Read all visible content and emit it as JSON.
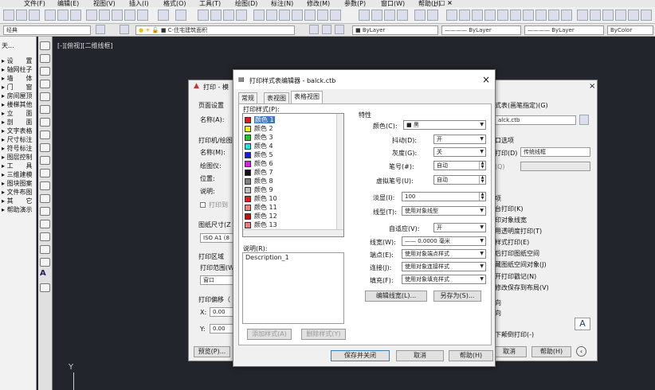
{
  "menubar": {
    "items": [
      "文件(F)",
      "编辑(E)",
      "视图(V)",
      "插入(I)",
      "格式(O)",
      "工具(T)",
      "绘图(D)",
      "标注(N)",
      "修改(M)",
      "参数(P)",
      "窗口(W)",
      "帮助(H)"
    ]
  },
  "toolbar2": {
    "workspace": "经典",
    "layer": "C-住宅建筑面积",
    "bylayer1": "ByLayer",
    "bylayer2": "ByLayer",
    "bylayer3": "ByLayer",
    "bycolor": "ByColor"
  },
  "leftpanel": {
    "title": "天...",
    "items": [
      "设　　置",
      "轴网柱子",
      "墙　　体",
      "门　　窗",
      "房间屋顶",
      "楼梯其他",
      "立　　面",
      "剖　　面",
      "文字表格",
      "尺寸标注",
      "符号标注",
      "图层控制",
      "工　　具",
      "三维建模",
      "图块图案",
      "文件布图",
      "其　　它",
      "帮助演示"
    ]
  },
  "viewport": {
    "label": "[-][俯视][二维线框]",
    "axis_y": "Y"
  },
  "print_dialog": {
    "title_part": "打印 - 模",
    "page_setup": "页面设置",
    "name_label": "名称(A):",
    "printer_section": "打印机/绘图",
    "printer_name": "名称(M):",
    "plotter": "绘图仪:",
    "location": "位置:",
    "description": "说明:",
    "print_to_file": "打印到",
    "paper_size": "图纸尺寸(Z",
    "paper_value": "ISO A1 (8",
    "print_area": "打印区域",
    "print_range": "打印范围(W",
    "range_value": "窗口",
    "print_offset": "打印偏移（",
    "x_label": "X:",
    "x_value": "0.00",
    "y_label": "Y:",
    "y_value": "0.00",
    "preview_btn": "预览(P)...",
    "right_style_table": "式表(画笔指定)(G)",
    "ctb_value": "alck.ctb",
    "shaded_viewport": "口选项",
    "shade_print": "打印(D)",
    "shade_value": "传统线框",
    "quality": "(Q)",
    "options": "项",
    "opts": [
      "台打印(K)",
      "印对象线宽",
      "用透明度打印(T)",
      "样式打印(E)",
      "后打印图纸空间",
      "藏图纸空间对象(J)",
      "开打印戳记(N)",
      "修改保存到布局(V)"
    ],
    "orientation": [
      "向",
      "向",
      "下颠倒打印(-)"
    ],
    "cancel": "取消",
    "help": "帮助(H)",
    "orientation_icon": "A"
  },
  "editor": {
    "title": "打印样式表编辑器 - balck.ctb",
    "close": "×",
    "tabs": [
      "常规",
      "表视图",
      "表格视图"
    ],
    "print_styles_label": "打印样式(P):",
    "styles": [
      {
        "name": "颜色 1",
        "color": "#e21c1c"
      },
      {
        "name": "颜色 2",
        "color": "#f2f21a"
      },
      {
        "name": "颜色 3",
        "color": "#1ccc1c"
      },
      {
        "name": "颜色 4",
        "color": "#1ae6e6"
      },
      {
        "name": "颜色 5",
        "color": "#1a1ae6"
      },
      {
        "name": "颜色 6",
        "color": "#e61ae6"
      },
      {
        "name": "颜色 7",
        "color": "#111111"
      },
      {
        "name": "颜色 8",
        "color": "#808080"
      },
      {
        "name": "颜色 9",
        "color": "#c0c0c0"
      },
      {
        "name": "颜色 10",
        "color": "#e21c1c"
      },
      {
        "name": "颜色 11",
        "color": "#f08080"
      },
      {
        "name": "颜色 12",
        "color": "#c01010"
      },
      {
        "name": "颜色 13",
        "color": "#e08080"
      }
    ],
    "desc_label": "说明(R):",
    "desc_value": "Description_1",
    "add_style": "添加样式(A)",
    "delete_style": "删除样式(Y)",
    "props_label": "特性",
    "color_label": "颜色(C):",
    "color_value": "■ 黑",
    "dither_label": "抖动(D):",
    "dither_value": "开",
    "gray_label": "灰度(G):",
    "gray_value": "关",
    "pen_label": "笔号(#):",
    "pen_value": "自动",
    "vpen_label": "虚拟笔号(U):",
    "vpen_value": "自动",
    "screen_label": "淡显(I):",
    "screen_value": "100",
    "linetype_label": "线型(T):",
    "linetype_value": "使用对象线型",
    "adaptive_label": "自适应(V):",
    "adaptive_value": "开",
    "lineweight_label": "线宽(W):",
    "lineweight_value": "—— 0.0000 毫米",
    "endpoint_label": "端点(E):",
    "endpoint_value": "使用对象端点样式",
    "join_label": "连接(J):",
    "join_value": "使用对象连接样式",
    "fill_label": "填充(F):",
    "fill_value": "使用对象填充样式",
    "edit_lw": "编辑线宽(L)...",
    "save_as": "另存为(S)...",
    "save_close": "保存并关闭",
    "cancel": "取消",
    "help": "帮助(H)"
  }
}
